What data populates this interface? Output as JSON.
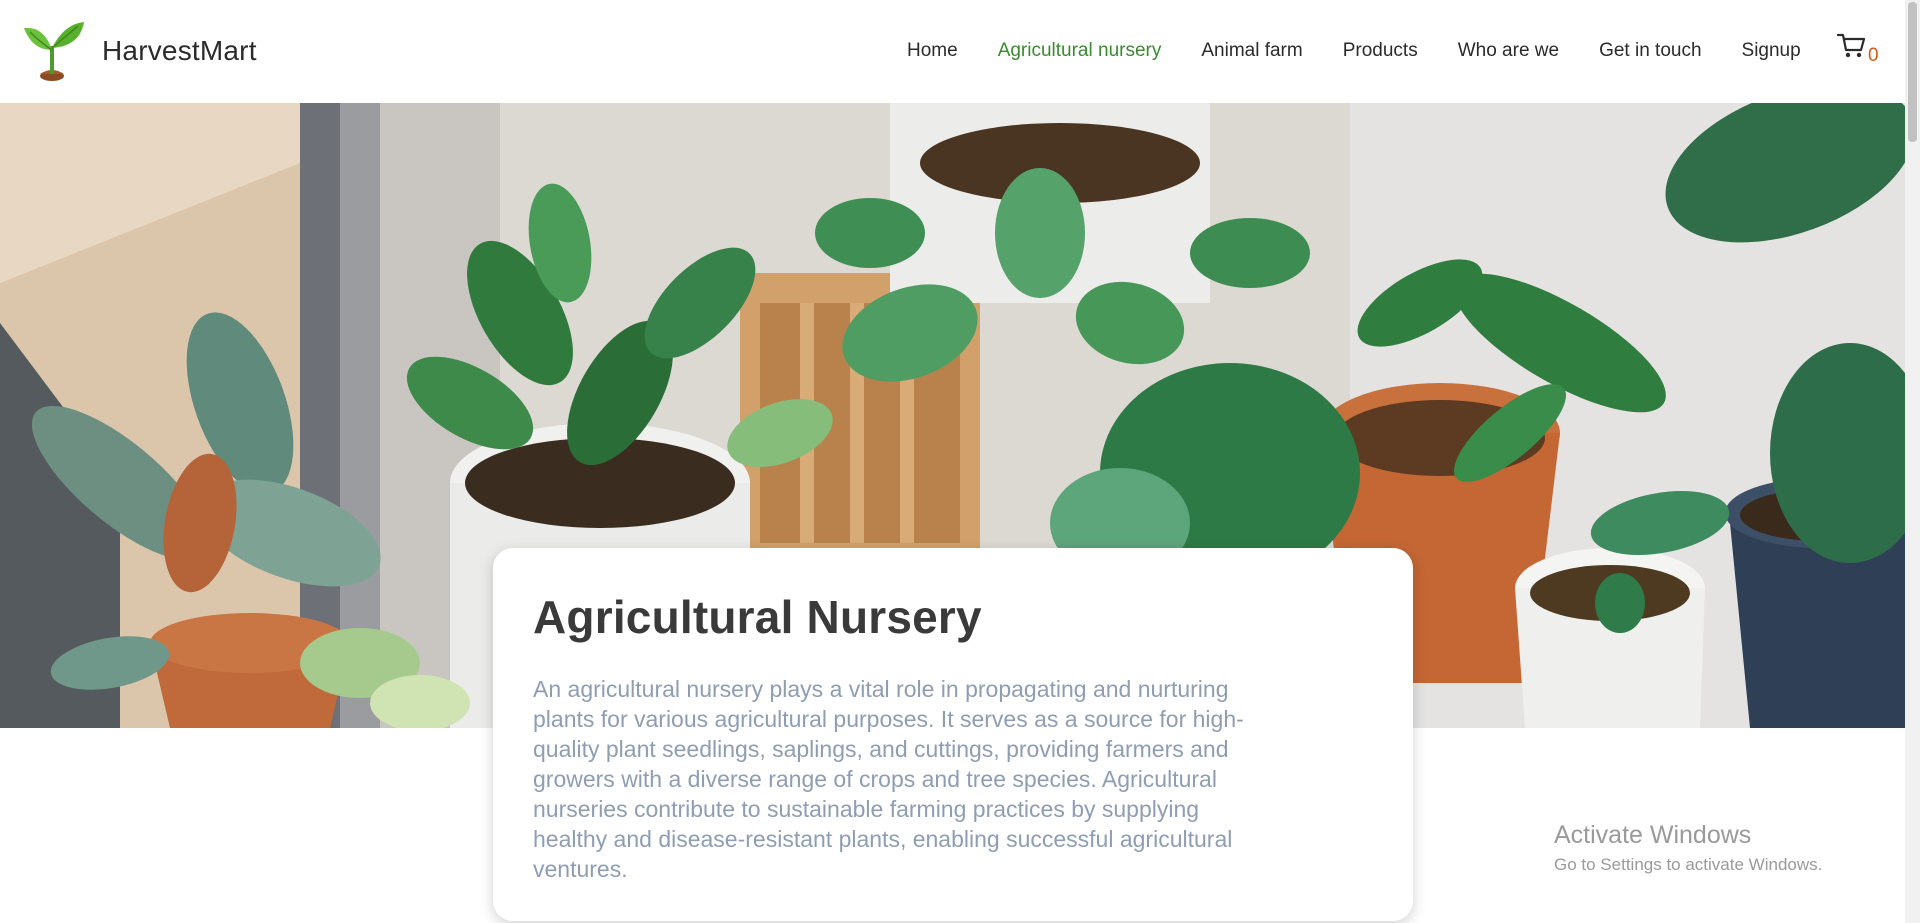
{
  "brand": {
    "name": "HarvestMart",
    "logo_icon": "sprout-icon"
  },
  "nav": {
    "items": [
      {
        "label": "Home",
        "active": false
      },
      {
        "label": "Agricultural nursery",
        "active": true
      },
      {
        "label": "Animal farm",
        "active": false
      },
      {
        "label": "Products",
        "active": false
      },
      {
        "label": "Who are we",
        "active": false
      },
      {
        "label": "Get in touch",
        "active": false
      },
      {
        "label": "Signup",
        "active": false
      }
    ],
    "cart_icon": "cart-icon",
    "cart_count": "0"
  },
  "hero": {
    "image": "potted-plants-photo"
  },
  "card": {
    "title": "Agricultural Nursery",
    "description": "An agricultural nursery plays a vital role in propagating and nurturing plants for various agricultural purposes. It serves as a source for high-quality plant seedlings, saplings, and cuttings, providing farmers and growers with a diverse range of crops and tree species. Agricultural nurseries contribute to sustainable farming practices by supplying healthy and disease-resistant plants, enabling successful agricultural ventures."
  },
  "watermark": {
    "title": "Activate Windows",
    "subtitle": "Go to Settings to activate Windows."
  },
  "colors": {
    "active_nav": "#3a8a2e",
    "cart_count": "#d55a1a",
    "description": "#8f9db3",
    "title": "#3a3a3a"
  }
}
